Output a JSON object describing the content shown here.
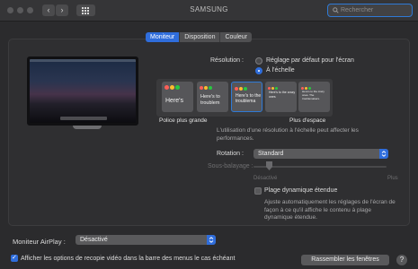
{
  "window": {
    "title": "SAMSUNG",
    "nav_back": "‹",
    "nav_fwd": "›"
  },
  "search": {
    "placeholder": "Rechercher"
  },
  "tabs": [
    {
      "label": "Moniteur",
      "active": true
    },
    {
      "label": "Disposition",
      "active": false
    },
    {
      "label": "Couleur",
      "active": false
    }
  ],
  "resolution": {
    "label": "Résolution :",
    "options": [
      {
        "label": "Réglage par défaut pour l'écran",
        "selected": false
      },
      {
        "label": "À l'échelle",
        "selected": true
      }
    ]
  },
  "scale": {
    "thumb_text": "Here's to the crazy ones. The troublemakers.",
    "thumbs": [
      {
        "text": "Here's"
      },
      {
        "text": "Here's to troublem"
      },
      {
        "text": "Here's to the troublema"
      },
      {
        "text": "Here's to the crazy ones"
      },
      {
        "text": "Here's to the crazy ones. The troublemakers."
      }
    ],
    "selected_index": 2,
    "left_caption": "Police plus grande",
    "right_caption": "Plus d'espace",
    "note": "L'utilisation d'une résolution à l'échelle peut affecter les performances."
  },
  "rotation": {
    "label": "Rotation :",
    "value": "Standard"
  },
  "underscan": {
    "label": "Sous-balayage :",
    "min_label": "Désactivé",
    "max_label": "Plus",
    "value_fraction": 0.1
  },
  "hdr": {
    "label": "Plage dynamique étendue",
    "checked": false,
    "note": "Ajuste automatiquement les réglages de l'écran de façon à ce qu'il affiche le contenu à plage dynamique étendue."
  },
  "airplay": {
    "label": "Moniteur AirPlay :",
    "value": "Désactivé"
  },
  "mirroring": {
    "label": "Afficher les options de recopie vidéo dans la barre des menus le cas échéant",
    "checked": true
  },
  "gather_button": "Rassembler les fenêtres",
  "help_button": "?",
  "colors": {
    "accent": "#2f6ddb",
    "background": "#2b2b2d"
  }
}
